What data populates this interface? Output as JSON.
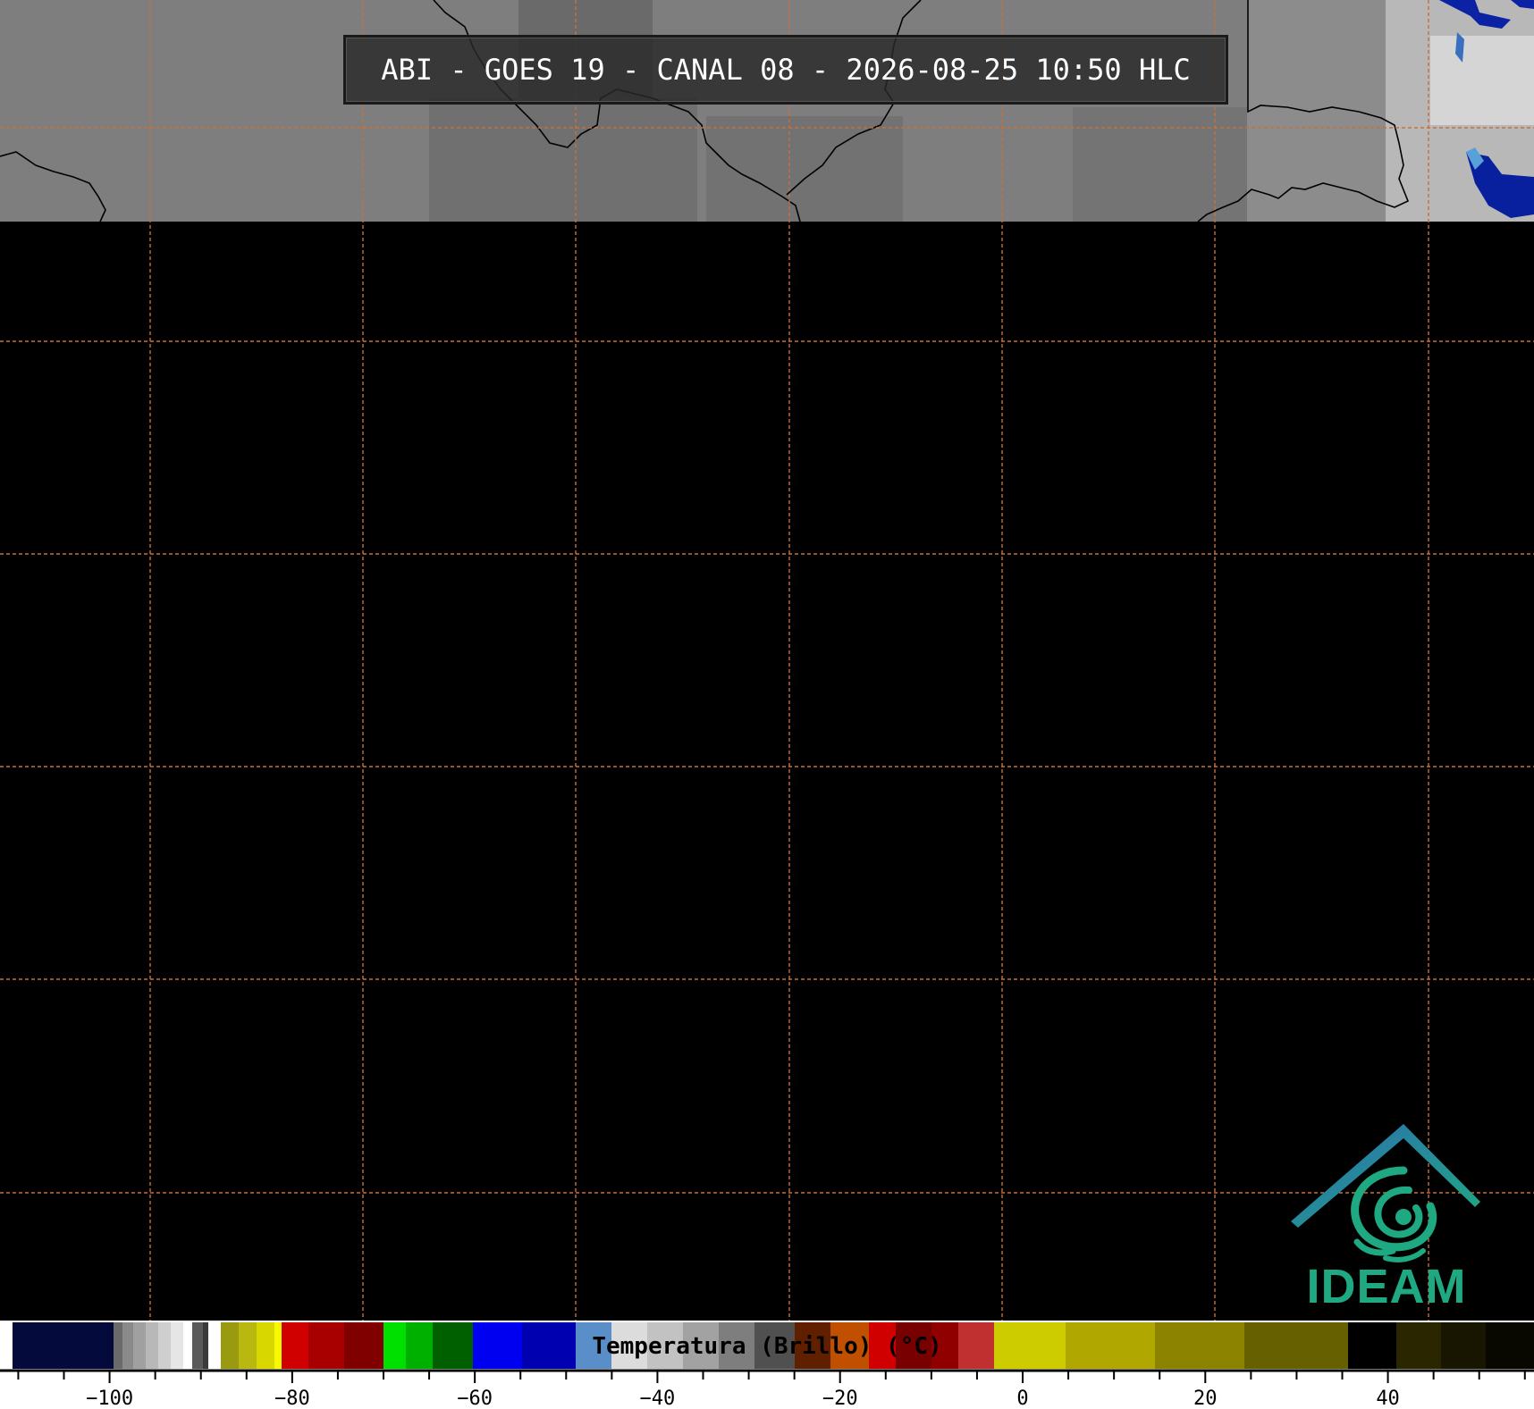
{
  "title": "ABI - GOES 19 - CANAL 08 - 2026-08-25 10:50 HLC",
  "colorbar": {
    "label": "Temperatura (Brillo) (°C)",
    "range": [
      -112,
      56
    ],
    "ticks": [
      -100,
      -80,
      -60,
      -40,
      -20,
      0,
      20,
      40
    ],
    "tick_labels": [
      "−100",
      "−80",
      "−60",
      "−40",
      "−20",
      "0",
      "20",
      "40"
    ]
  },
  "logo": {
    "text": "IDEAM",
    "primary_color": "#1fa982",
    "secondary_color": "#2c6db0"
  },
  "map": {
    "background_color": "#000000",
    "grid_color": "#c8703a",
    "border_color": "#000000",
    "imagery_colors": [
      "#6e6e6e",
      "#7f7f7f",
      "#8a8a8a",
      "#c9c9c9",
      "#0b2fa8"
    ]
  }
}
